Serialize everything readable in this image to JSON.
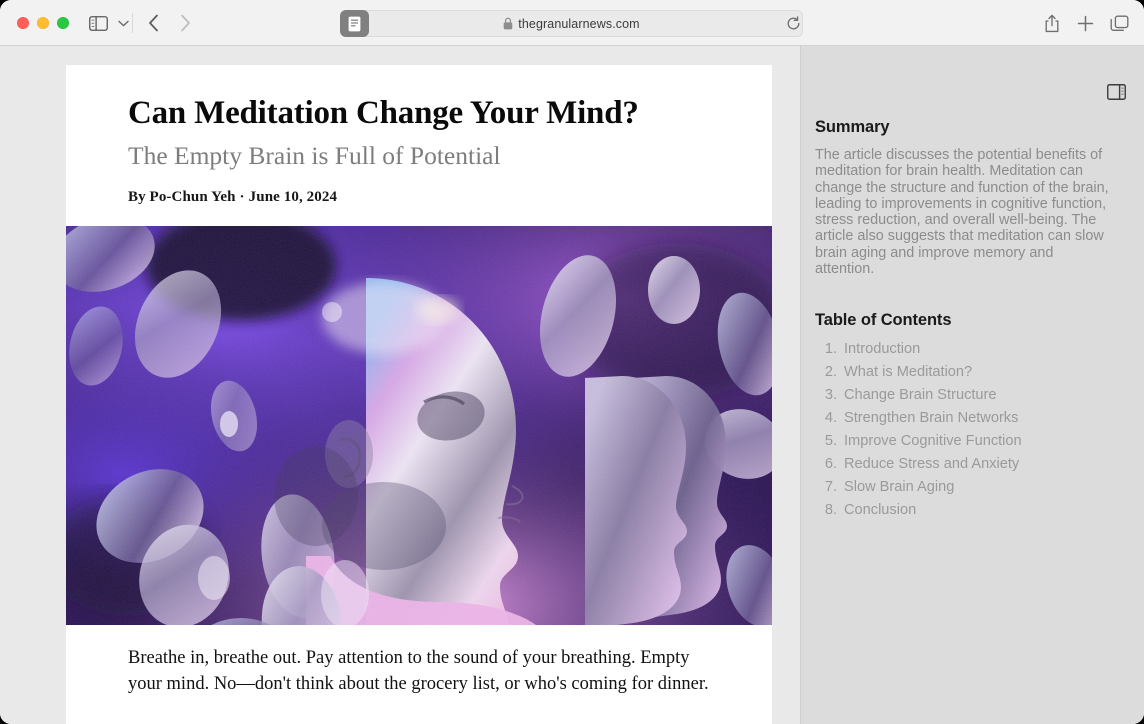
{
  "window": {
    "traffic_lights": [
      {
        "name": "close",
        "color": "#ff5f57"
      },
      {
        "name": "minimize",
        "color": "#febc2e"
      },
      {
        "name": "maximize",
        "color": "#28c840"
      }
    ]
  },
  "toolbar": {
    "sidebar_toggle_icon": "sidebar-left-icon",
    "sidebar_chevron_icon": "chevron-down-icon",
    "back_icon": "chevron-left-icon",
    "forward_icon": "chevron-right-icon",
    "reader_icon": "reader-mode-icon",
    "lock_icon": "lock-icon",
    "url": "thegranularnews.com",
    "reload_icon": "reload-icon",
    "share_icon": "share-icon",
    "newtab_icon": "plus-icon",
    "tabs_icon": "tab-overview-icon"
  },
  "article": {
    "title": "Can Meditation Change Your Mind?",
    "subtitle": "The Empty Brain is Full of Potential",
    "byline_author": "By Po-Chun Yeh",
    "byline_separator": "·",
    "byline_date": "June 10, 2024",
    "hero_alt": "abstract-brain-heads-illustration",
    "body_paragraph": "Breathe in, breathe out. Pay attention to the sound of your breathing. Empty your mind. No—don't think about the grocery list, or who's coming for dinner."
  },
  "sidebar": {
    "toggle_icon": "sidebar-right-icon",
    "summary_heading": "Summary",
    "summary_text": "The article discusses the potential benefits of meditation for brain health. Meditation can change the structure and function of the brain, leading to improvements in cognitive function, stress reduction, and overall well-being. The article also suggests that meditation can slow brain aging and improve memory and attention.",
    "toc_heading": "Table of Contents",
    "toc_items": [
      {
        "num": "1.",
        "label": "Introduction"
      },
      {
        "num": "2.",
        "label": "What is Meditation?"
      },
      {
        "num": "3.",
        "label": "Change Brain Structure"
      },
      {
        "num": "4.",
        "label": "Strengthen Brain Networks"
      },
      {
        "num": "5.",
        "label": "Improve Cognitive Function"
      },
      {
        "num": "6.",
        "label": "Reduce Stress and Anxiety"
      },
      {
        "num": "7.",
        "label": "Slow Brain Aging"
      },
      {
        "num": "8.",
        "label": "Conclusion"
      }
    ]
  },
  "colors": {
    "toolbar_bg": "#f2f2f2",
    "page_bg": "#e9e9e9",
    "sidebar_bg": "#dcdcdc",
    "card_bg": "#ffffff",
    "muted_text": "#8c8c8c",
    "subtitle_text": "#7d7d7d"
  }
}
